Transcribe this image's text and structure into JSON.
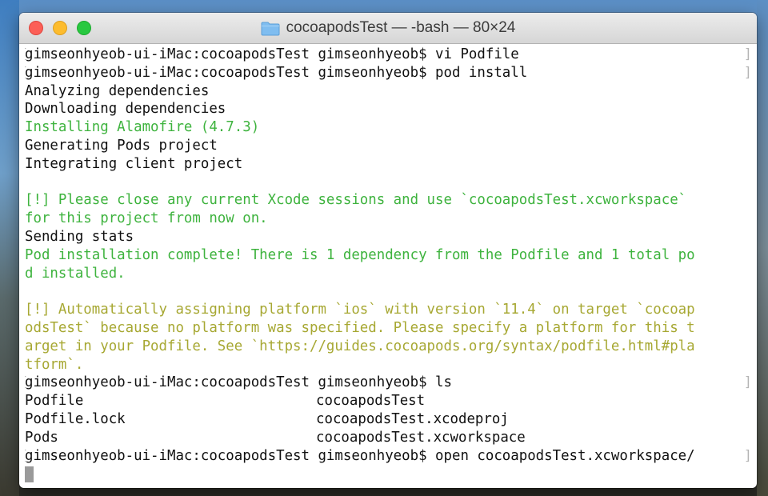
{
  "window": {
    "title": "cocoapodsTest — -bash — 80×24",
    "title_icon": "folder-icon",
    "traffic_lights": {
      "close": "#fc5f57",
      "minimize": "#fdbc2e",
      "maximize": "#28c840"
    }
  },
  "terminal": {
    "colors": {
      "default": "#111111",
      "success": "#3eb33e",
      "warning": "#a7a833"
    },
    "lines": [
      {
        "type": "prompt",
        "text": "gimseonhyeob-ui-iMac:cocoapodsTest gimseonhyeob$ vi Podfile"
      },
      {
        "type": "prompt",
        "text": "gimseonhyeob-ui-iMac:cocoapodsTest gimseonhyeob$ pod install"
      },
      {
        "type": "out",
        "text": "Analyzing dependencies"
      },
      {
        "type": "out",
        "text": "Downloading dependencies"
      },
      {
        "type": "green",
        "text": "Installing Alamofire (4.7.3)"
      },
      {
        "type": "out",
        "text": "Generating Pods project"
      },
      {
        "type": "out",
        "text": "Integrating client project"
      },
      {
        "type": "out",
        "text": ""
      },
      {
        "type": "green",
        "text": "[!] Please close any current Xcode sessions and use `cocoapodsTest.xcworkspace`"
      },
      {
        "type": "green",
        "text": "for this project from now on."
      },
      {
        "type": "out",
        "text": "Sending stats"
      },
      {
        "type": "green",
        "text": "Pod installation complete! There is 1 dependency from the Podfile and 1 total po"
      },
      {
        "type": "green",
        "text": "d installed."
      },
      {
        "type": "out",
        "text": ""
      },
      {
        "type": "olive",
        "text": "[!] Automatically assigning platform `ios` with version `11.4` on target `cocoap"
      },
      {
        "type": "olive",
        "text": "odsTest` because no platform was specified. Please specify a platform for this t"
      },
      {
        "type": "olive",
        "text": "arget in your Podfile. See `https://guides.cocoapods.org/syntax/podfile.html#pla"
      },
      {
        "type": "olive",
        "text": "tform`."
      },
      {
        "type": "prompt",
        "text": "gimseonhyeob-ui-iMac:cocoapodsTest gimseonhyeob$ ls"
      },
      {
        "type": "cols",
        "left": "Podfile",
        "right": "cocoapodsTest"
      },
      {
        "type": "cols",
        "left": "Podfile.lock",
        "right": "cocoapodsTest.xcodeproj"
      },
      {
        "type": "cols",
        "left": "Pods",
        "right": "cocoapodsTest.xcworkspace"
      },
      {
        "type": "prompt",
        "text": "gimseonhyeob-ui-iMac:cocoapodsTest gimseonhyeob$ open cocoapodsTest.xcworkspace/"
      },
      {
        "type": "cursor",
        "text": ""
      }
    ]
  }
}
